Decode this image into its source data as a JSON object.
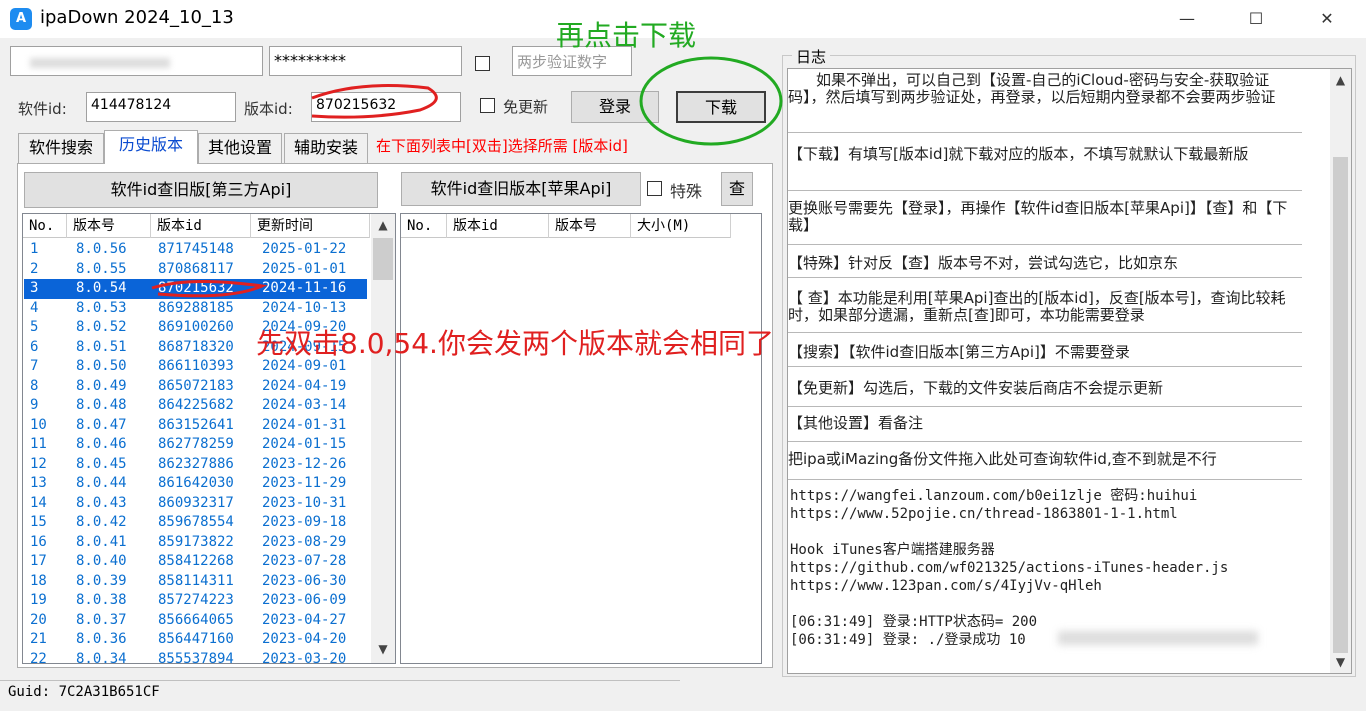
{
  "window": {
    "title": "ipaDown 2024_10_13",
    "minimize": "—",
    "maximize": "☐",
    "close": "✕",
    "app_icon": "A"
  },
  "login": {
    "account_value": "",
    "password_value": "*********",
    "twofa_placeholder": "两步验证数字",
    "software_id_label": "软件id:",
    "software_id_value": "414478124",
    "version_id_label": "版本id:",
    "version_id_value": "870215632",
    "no_update_label": "免更新",
    "login_button": "登录",
    "download_button": "下载"
  },
  "annotations": {
    "green_text": "再点击下载",
    "red_text": "先双击8.0,54.你会发两个版本就会相同了"
  },
  "tabs": [
    "软件搜索",
    "历史版本",
    "其他设置",
    "辅助安装"
  ],
  "tab_hint": "在下面列表中[双击]选择所需 [版本id]",
  "left_panel": {
    "query_button": "软件id查旧版[第三方Api]",
    "columns": [
      "No.",
      "版本号",
      "版本id",
      "更新时间"
    ],
    "rows": [
      [
        "1",
        "8.0.56",
        "871745148",
        "2025-01-22"
      ],
      [
        "2",
        "8.0.55",
        "870868117",
        "2025-01-01"
      ],
      [
        "3",
        "8.0.54",
        "870215632",
        "2024-11-16"
      ],
      [
        "4",
        "8.0.53",
        "869288185",
        "2024-10-13"
      ],
      [
        "5",
        "8.0.52",
        "869100260",
        "2024-09-20"
      ],
      [
        "6",
        "8.0.51",
        "868718320",
        "2024-09-15"
      ],
      [
        "7",
        "8.0.50",
        "866110393",
        "2024-09-01"
      ],
      [
        "8",
        "8.0.49",
        "865072183",
        "2024-04-19"
      ],
      [
        "9",
        "8.0.48",
        "864225682",
        "2024-03-14"
      ],
      [
        "10",
        "8.0.47",
        "863152641",
        "2024-01-31"
      ],
      [
        "11",
        "8.0.46",
        "862778259",
        "2024-01-15"
      ],
      [
        "12",
        "8.0.45",
        "862327886",
        "2023-12-26"
      ],
      [
        "13",
        "8.0.44",
        "861642030",
        "2023-11-29"
      ],
      [
        "14",
        "8.0.43",
        "860932317",
        "2023-10-31"
      ],
      [
        "15",
        "8.0.42",
        "859678554",
        "2023-09-18"
      ],
      [
        "16",
        "8.0.41",
        "859173822",
        "2023-08-29"
      ],
      [
        "17",
        "8.0.40",
        "858412268",
        "2023-07-28"
      ],
      [
        "18",
        "8.0.39",
        "858114311",
        "2023-06-30"
      ],
      [
        "19",
        "8.0.38",
        "857274223",
        "2023-06-09"
      ],
      [
        "20",
        "8.0.37",
        "856664065",
        "2023-04-27"
      ],
      [
        "21",
        "8.0.36",
        "856447160",
        "2023-04-20"
      ],
      [
        "22",
        "8.0.34",
        "855537894",
        "2023-03-20"
      ]
    ],
    "selected_row": 3
  },
  "right_panel": {
    "query_button": "软件id查旧版本[苹果Api]",
    "special_label": "特殊",
    "check_button": "查",
    "columns": [
      "No.",
      "版本id",
      "版本号",
      "大小(M)"
    ]
  },
  "log": {
    "title": "日志",
    "entries": [
      "如果不弹出，可以自己到【设置-自己的iCloud-密码与安全-获取验证码】，然后填写到两步验证处，再登录，以后短期内登录都不会要两步验证",
      "【下载】有填写[版本id]就下载对应的版本，不填写就默认下载最新版",
      "更换账号需要先【登录】，再操作【软件id查旧版本[苹果Api]】【查】和【下载】",
      "【特殊】针对反【查】版本号不对，尝试勾选它，比如京东",
      "【 查】本功能是利用[苹果Api]查出的[版本id]，反查[版本号]，查询比较耗时，如果部分遗漏，重新点[查]即可，本功能需要登录",
      "【搜索】【软件id查旧版本[第三方Api]】不需要登录",
      "【免更新】勾选后，下载的文件安装后商店不会提示更新",
      "【其他设置】看备注",
      "把ipa或iMazing备份文件拖入此处可查询软件id,查不到就是不行"
    ],
    "links": "https://wangfei.lanzoum.com/b0ei1zlje 密码:huihui\nhttps://www.52pojie.cn/thread-1863801-1-1.html\n\nHook iTunes客户端搭建服务器\nhttps://github.com/wf021325/actions-iTunes-header.js\nhttps://www.123pan.com/s/4IyjVv-qHleh",
    "status": "[06:31:49] 登录:HTTP状态码= 200\n[06:31:49] 登录: ./登录成功 10"
  },
  "footer": {
    "guid": "Guid: 7C2A31B651CF"
  },
  "colors": {
    "accent": "#0a64d8",
    "annotation_green": "#22aa22",
    "annotation_red": "#e02020",
    "hint_red": "#ff0000"
  }
}
